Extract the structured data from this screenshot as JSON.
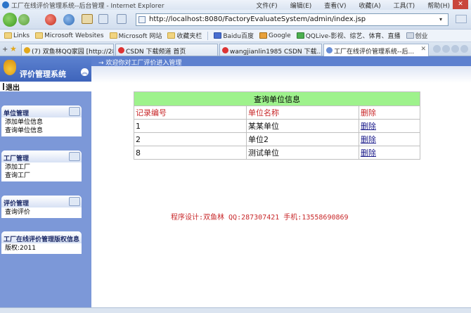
{
  "browser": {
    "window_title": "工厂在线评价管理系统--后台管理 - Internet Explorer",
    "menu": [
      "文件(F)",
      "编辑(E)",
      "查看(V)",
      "收藏(A)",
      "工具(T)",
      "帮助(H)"
    ],
    "address": "http://localhost:8080/FactoryEvaluateSystem/admin/index.jsp",
    "favorites": [
      "Links",
      "Microsoft Websites",
      "Microsoft 网站",
      "收藏夹栏",
      "Baidu百度",
      "Google",
      "QQLive-影视、综艺、体育、直播",
      "创业"
    ],
    "tabs": [
      {
        "label": "(7) 双鱼林QQ家园 [http://28..."
      },
      {
        "label": "CSDN 下载频道 首页"
      },
      {
        "label": "wangjianlin1985 CSDN 下载..."
      },
      {
        "label": "工厂在线评价管理系统--后..."
      }
    ]
  },
  "sidebar": {
    "system_label": "评价管理系统",
    "logout_label": "退出",
    "panels": [
      {
        "title": "单位管理",
        "items": [
          "添加单位信息",
          "查询单位信息"
        ]
      },
      {
        "title": "工厂管理",
        "items": [
          "添加工厂",
          "查询工厂"
        ]
      },
      {
        "title": "评价管理",
        "items": [
          "查询评价"
        ]
      },
      {
        "title": "工厂在线评价管理版权信息",
        "items": [
          "版权:2011"
        ]
      }
    ]
  },
  "main": {
    "welcome": "→ 欢迎你对工厂评价进入管理",
    "table": {
      "caption": "查询单位信息",
      "headers": [
        "记录编号",
        "单位名称",
        "删除"
      ],
      "rows": [
        {
          "id": "1",
          "name": "某某单位",
          "action": "删除"
        },
        {
          "id": "2",
          "name": "单位2",
          "action": "删除"
        },
        {
          "id": "8",
          "name": "测试单位",
          "action": "删除"
        }
      ]
    },
    "credit": "程序设计:双鱼林 QQ:287307421 手机:13558690869"
  }
}
